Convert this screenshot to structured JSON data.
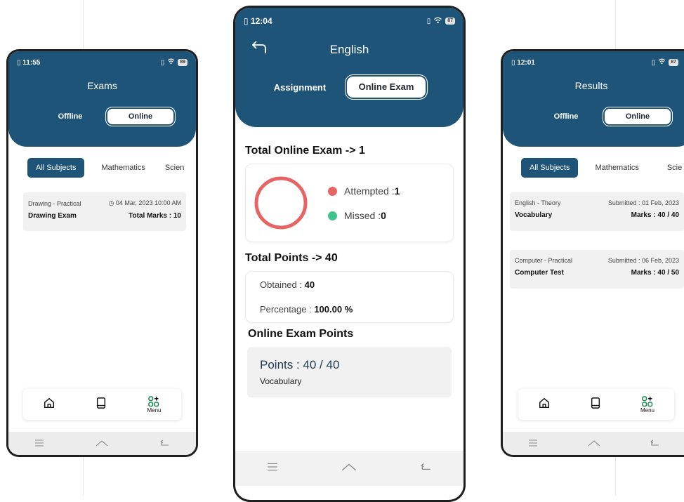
{
  "left": {
    "status_time": "11:55",
    "battery": "89",
    "title": "Exams",
    "toggle_off": "Offline",
    "toggle_on": "Online",
    "chips": [
      "All Subjects",
      "Mathematics",
      "Scien"
    ],
    "card": {
      "subject": "Drawing - Practical",
      "date": "04 Mar, 2023 10:00 AM",
      "name": "Drawing Exam",
      "marks": "Total Marks : 10"
    },
    "nav_menu": "Menu"
  },
  "center": {
    "status_time": "12:04",
    "battery": "87",
    "title": "English",
    "tab_assignment": "Assignment",
    "tab_online_exam": "Online Exam",
    "total_exam_heading": "Total Online Exam -> 1",
    "attempted_label": "Attempted : ",
    "attempted_value": "1",
    "missed_label": "Missed : ",
    "missed_value": "0",
    "total_points_heading": "Total Points -> 40",
    "obtained_label": "Obtained : ",
    "obtained_value": "40",
    "percentage_label": "Percentage : ",
    "percentage_value": "100.00 %",
    "exam_points_heading": "Online Exam Points",
    "points_line": "Points : 40 / 40",
    "points_subject": "Vocabulary"
  },
  "right": {
    "status_time": "12:01",
    "battery": "87",
    "title": "Results",
    "toggle_off": "Offline",
    "toggle_on": "Online",
    "chips": [
      "All Subjects",
      "Mathematics",
      "Scie"
    ],
    "cards": [
      {
        "subject": "English - Theory",
        "submitted": "Submitted : 01 Feb, 2023",
        "name": "Vocabulary",
        "marks": "Marks : 40 / 40"
      },
      {
        "subject": "Computer - Practical",
        "submitted": "Submitted : 06 Feb, 2023",
        "name": "Computer Test",
        "marks": "Marks : 40 / 50"
      }
    ],
    "nav_menu": "Menu"
  },
  "colors": {
    "header": "#1d5478",
    "attempted": "#e86363",
    "missed": "#3fc48b"
  },
  "icons": [
    "sim-icon",
    "vibrate-icon",
    "wifi-icon",
    "battery-icon",
    "back-arrow-icon",
    "home-icon",
    "book-icon",
    "menu-grid-icon",
    "clock-icon",
    "nav-menu-icon",
    "nav-home-icon",
    "nav-back-icon"
  ]
}
